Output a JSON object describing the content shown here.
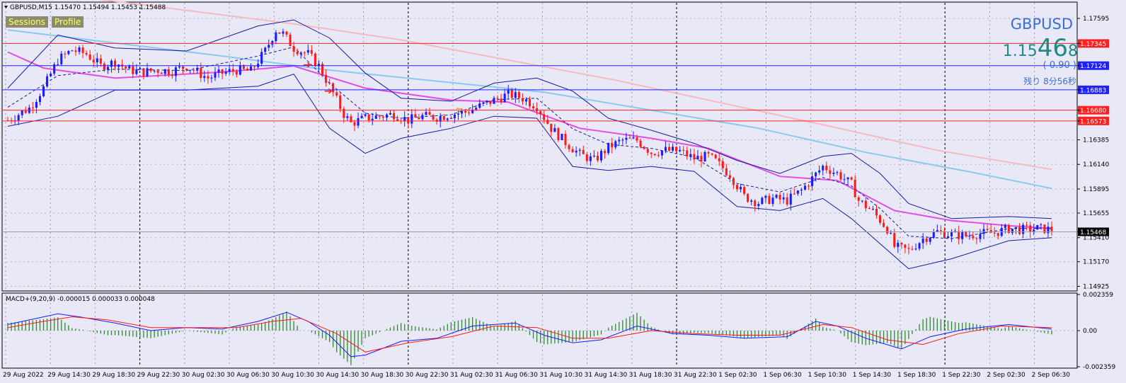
{
  "header": {
    "title": "GBPUSD,M15  1.15470 1.15494 1.15453 1.15488"
  },
  "buttons": {
    "sessions": "Sessions",
    "profile": "Profile"
  },
  "info": {
    "symbol": "GBPUSD",
    "price_a": "1.15",
    "price_b": "46",
    "price_c": "8",
    "change": "( 0.90 )",
    "remaining": "残り 8分56秒"
  },
  "macd": {
    "title": "MACD+(9,20,9) -0.000015 0.000033 0.000048"
  },
  "colors": {
    "background": "#e8e8f6",
    "bull": "#1a1aff",
    "bear": "#ff1a1a",
    "bollinger": "#1a1aa0",
    "ma_magenta": "#e34de3",
    "ma_sky": "#87cbee",
    "ma_pink": "#f7b9c3",
    "macd_line": "#1a1aff",
    "signal_line": "#ff1a1a",
    "histogram": "#2e8b2e",
    "level_red": "#ff2020",
    "level_blue": "#2020ff"
  },
  "chart_data": [
    {
      "type": "candlestick",
      "symbol": "GBPUSD",
      "timeframe": "M15",
      "ylim": [
        1.149,
        1.1775
      ],
      "y_ticks": [
        "1.17595",
        "1.17345",
        "1.17124",
        "1.16883",
        "1.16680",
        "1.16573",
        "1.16385",
        "1.16140",
        "1.15895",
        "1.15655",
        "1.15468",
        "1.15410",
        "1.15170",
        "1.14925"
      ],
      "x_ticks": [
        "29 Aug 2022",
        "29 Aug 14:30",
        "29 Aug 18:30",
        "29 Aug 22:30",
        "30 Aug 02:30",
        "30 Aug 06:30",
        "30 Aug 10:30",
        "30 Aug 14:30",
        "30 Aug 18:30",
        "30 Aug 22:30",
        "31 Aug 02:30",
        "31 Aug 06:30",
        "31 Aug 10:30",
        "31 Aug 14:30",
        "31 Aug 18:30",
        "31 Aug 22:30",
        "1 Sep 02:30",
        "1 Sep 06:30",
        "1 Sep 10:30",
        "1 Sep 14:30",
        "1 Sep 18:30",
        "1 Sep 22:30",
        "2 Sep 02:30",
        "2 Sep 06:30"
      ],
      "levels": [
        {
          "label": "1.17345",
          "value": 1.17345,
          "color": "#ff2020"
        },
        {
          "label": "1.17124",
          "value": 1.17124,
          "color": "#2020ff"
        },
        {
          "label": "1.16883",
          "value": 1.16883,
          "color": "#2020ff"
        },
        {
          "label": "1.16680",
          "value": 1.1668,
          "color": "#ff2020"
        },
        {
          "label": "1.16573",
          "value": 1.16573,
          "color": "#ff2020"
        }
      ],
      "current_price": 1.15468,
      "close_path": [
        [
          0,
          1.1658
        ],
        [
          6,
          1.167
        ],
        [
          10,
          1.169
        ],
        [
          14,
          1.1718
        ],
        [
          18,
          1.1728
        ],
        [
          22,
          1.1724
        ],
        [
          26,
          1.1712
        ],
        [
          30,
          1.1716
        ],
        [
          34,
          1.1708
        ],
        [
          38,
          1.1706
        ],
        [
          42,
          1.1708
        ],
        [
          46,
          1.1707
        ],
        [
          50,
          1.1712
        ],
        [
          54,
          1.1704
        ],
        [
          56,
          1.17
        ],
        [
          60,
          1.1705
        ],
        [
          64,
          1.1708
        ],
        [
          68,
          1.1707
        ],
        [
          72,
          1.1727
        ],
        [
          75,
          1.1748
        ],
        [
          77,
          1.1744
        ],
        [
          80,
          1.173
        ],
        [
          84,
          1.1724
        ],
        [
          87,
          1.1712
        ],
        [
          90,
          1.1692
        ],
        [
          94,
          1.1664
        ],
        [
          96,
          1.1655
        ],
        [
          100,
          1.166
        ],
        [
          104,
          1.1662
        ],
        [
          108,
          1.1664
        ],
        [
          112,
          1.1658
        ],
        [
          116,
          1.1662
        ],
        [
          120,
          1.1661
        ],
        [
          124,
          1.1664
        ],
        [
          128,
          1.1666
        ],
        [
          132,
          1.1672
        ],
        [
          136,
          1.1678
        ],
        [
          140,
          1.1684
        ],
        [
          144,
          1.168
        ],
        [
          148,
          1.1672
        ],
        [
          152,
          1.165
        ],
        [
          156,
          1.1636
        ],
        [
          160,
          1.1624
        ],
        [
          164,
          1.1618
        ],
        [
          168,
          1.1631
        ],
        [
          172,
          1.1638
        ],
        [
          176,
          1.1638
        ],
        [
          180,
          1.1626
        ],
        [
          184,
          1.1628
        ],
        [
          188,
          1.1627
        ],
        [
          192,
          1.162
        ],
        [
          196,
          1.1622
        ],
        [
          198,
          1.1617
        ],
        [
          202,
          1.1604
        ],
        [
          206,
          1.1582
        ],
        [
          210,
          1.1576
        ],
        [
          214,
          1.158
        ],
        [
          218,
          1.1578
        ],
        [
          222,
          1.1588
        ],
        [
          226,
          1.1604
        ],
        [
          228,
          1.1612
        ],
        [
          232,
          1.1605
        ],
        [
          236,
          1.1594
        ],
        [
          238,
          1.1578
        ],
        [
          242,
          1.1567
        ],
        [
          246,
          1.155
        ],
        [
          248,
          1.1532
        ],
        [
          252,
          1.1528
        ],
        [
          256,
          1.154
        ],
        [
          260,
          1.1547
        ],
        [
          264,
          1.1544
        ],
        [
          268,
          1.1543
        ],
        [
          272,
          1.1545
        ],
        [
          276,
          1.1546
        ],
        [
          280,
          1.155
        ],
        [
          284,
          1.1549
        ],
        [
          288,
          1.155
        ],
        [
          292,
          1.1549
        ]
      ],
      "bollinger": {
        "upper": [
          [
            0,
            1.169
          ],
          [
            14,
            1.1743
          ],
          [
            30,
            1.173
          ],
          [
            50,
            1.1727
          ],
          [
            70,
            1.1752
          ],
          [
            80,
            1.1758
          ],
          [
            90,
            1.174
          ],
          [
            100,
            1.1705
          ],
          [
            110,
            1.168
          ],
          [
            124,
            1.1677
          ],
          [
            136,
            1.1695
          ],
          [
            148,
            1.17
          ],
          [
            158,
            1.1687
          ],
          [
            168,
            1.166
          ],
          [
            180,
            1.1648
          ],
          [
            192,
            1.1635
          ],
          [
            204,
            1.1618
          ],
          [
            216,
            1.1605
          ],
          [
            228,
            1.1622
          ],
          [
            236,
            1.1625
          ],
          [
            244,
            1.1605
          ],
          [
            252,
            1.1575
          ],
          [
            264,
            1.156
          ],
          [
            280,
            1.1562
          ],
          [
            292,
            1.156
          ]
        ],
        "lower": [
          [
            0,
            1.1652
          ],
          [
            14,
            1.1662
          ],
          [
            30,
            1.1688
          ],
          [
            50,
            1.1688
          ],
          [
            70,
            1.1692
          ],
          [
            80,
            1.1704
          ],
          [
            90,
            1.165
          ],
          [
            100,
            1.1625
          ],
          [
            110,
            1.164
          ],
          [
            124,
            1.165
          ],
          [
            136,
            1.1662
          ],
          [
            148,
            1.166
          ],
          [
            158,
            1.1612
          ],
          [
            168,
            1.1608
          ],
          [
            180,
            1.1612
          ],
          [
            192,
            1.1607
          ],
          [
            204,
            1.1572
          ],
          [
            216,
            1.1568
          ],
          [
            228,
            1.158
          ],
          [
            236,
            1.156
          ],
          [
            244,
            1.1535
          ],
          [
            252,
            1.151
          ],
          [
            264,
            1.152
          ],
          [
            280,
            1.1538
          ],
          [
            292,
            1.1541
          ]
        ]
      },
      "moving_averages": [
        {
          "color": "#e34de3",
          "points": [
            [
              0,
              1.1726
            ],
            [
              10,
              1.171
            ],
            [
              30,
              1.17
            ],
            [
              60,
              1.1706
            ],
            [
              80,
              1.1712
            ],
            [
              100,
              1.169
            ],
            [
              124,
              1.1678
            ],
            [
              140,
              1.1676
            ],
            [
              160,
              1.165
            ],
            [
              180,
              1.164
            ],
            [
              196,
              1.163
            ],
            [
              216,
              1.1602
            ],
            [
              232,
              1.1598
            ],
            [
              248,
              1.1568
            ],
            [
              264,
              1.1558
            ],
            [
              280,
              1.1553
            ],
            [
              292,
              1.155
            ]
          ]
        },
        {
          "color": "#87cbee",
          "points": [
            [
              0,
              1.1748
            ],
            [
              30,
              1.1735
            ],
            [
              60,
              1.1722
            ],
            [
              90,
              1.1708
            ],
            [
              120,
              1.1697
            ],
            [
              150,
              1.1686
            ],
            [
              180,
              1.1668
            ],
            [
              210,
              1.165
            ],
            [
              240,
              1.1626
            ],
            [
              270,
              1.1606
            ],
            [
              292,
              1.159
            ]
          ]
        },
        {
          "color": "#f7b9c3",
          "points": [
            [
              0,
              1.179
            ],
            [
              40,
              1.1772
            ],
            [
              80,
              1.1754
            ],
            [
              110,
              1.1738
            ],
            [
              140,
              1.1718
            ],
            [
              170,
              1.1698
            ],
            [
              200,
              1.1675
            ],
            [
              230,
              1.1652
            ],
            [
              260,
              1.1628
            ],
            [
              292,
              1.1609
            ]
          ]
        }
      ]
    },
    {
      "type": "macd",
      "title": "MACD+(9,20,9) -0.000015 0.000033 0.000048",
      "ylim": [
        -0.002359,
        0.002359
      ],
      "y_ticks": [
        "0.002359",
        "0.00",
        "-0.002359"
      ],
      "macd": [
        [
          0,
          0.0004
        ],
        [
          8,
          0.0008
        ],
        [
          14,
          0.0011
        ],
        [
          20,
          0.0009
        ],
        [
          30,
          0.0005
        ],
        [
          40,
          0.0
        ],
        [
          50,
          0.0002
        ],
        [
          60,
          0.0001
        ],
        [
          70,
          0.0006
        ],
        [
          78,
          0.0012
        ],
        [
          84,
          0.0006
        ],
        [
          90,
          -0.0003
        ],
        [
          96,
          -0.0017
        ],
        [
          100,
          -0.0016
        ],
        [
          110,
          -0.0007
        ],
        [
          120,
          -0.0005
        ],
        [
          130,
          0.0003
        ],
        [
          142,
          0.0005
        ],
        [
          150,
          -0.0003
        ],
        [
          158,
          -0.0008
        ],
        [
          166,
          -0.0006
        ],
        [
          176,
          0.0003
        ],
        [
          186,
          -0.0002
        ],
        [
          196,
          -0.0003
        ],
        [
          206,
          -0.0005
        ],
        [
          218,
          -0.0004
        ],
        [
          226,
          0.0006
        ],
        [
          232,
          0.0003
        ],
        [
          240,
          -0.0005
        ],
        [
          250,
          -0.0012
        ],
        [
          258,
          -0.0004
        ],
        [
          268,
          0.0001
        ],
        [
          280,
          0.0004
        ],
        [
          292,
          0.0001
        ]
      ],
      "signal": [
        [
          0,
          0.0002
        ],
        [
          10,
          0.0006
        ],
        [
          18,
          0.0009
        ],
        [
          28,
          0.0007
        ],
        [
          40,
          0.0002
        ],
        [
          52,
          0.0002
        ],
        [
          64,
          0.0002
        ],
        [
          74,
          0.0006
        ],
        [
          82,
          0.0008
        ],
        [
          92,
          -0.0002
        ],
        [
          100,
          -0.0014
        ],
        [
          112,
          -0.0008
        ],
        [
          124,
          -0.0004
        ],
        [
          136,
          0.0003
        ],
        [
          148,
          0.0002
        ],
        [
          158,
          -0.0005
        ],
        [
          168,
          -0.0005
        ],
        [
          180,
          0.0
        ],
        [
          192,
          -0.0002
        ],
        [
          204,
          -0.0003
        ],
        [
          216,
          -0.0003
        ],
        [
          228,
          0.0004
        ],
        [
          236,
          0.0002
        ],
        [
          246,
          -0.0006
        ],
        [
          256,
          -0.0009
        ],
        [
          266,
          -0.0002
        ],
        [
          278,
          0.0003
        ],
        [
          292,
          0.0002
        ]
      ]
    }
  ]
}
